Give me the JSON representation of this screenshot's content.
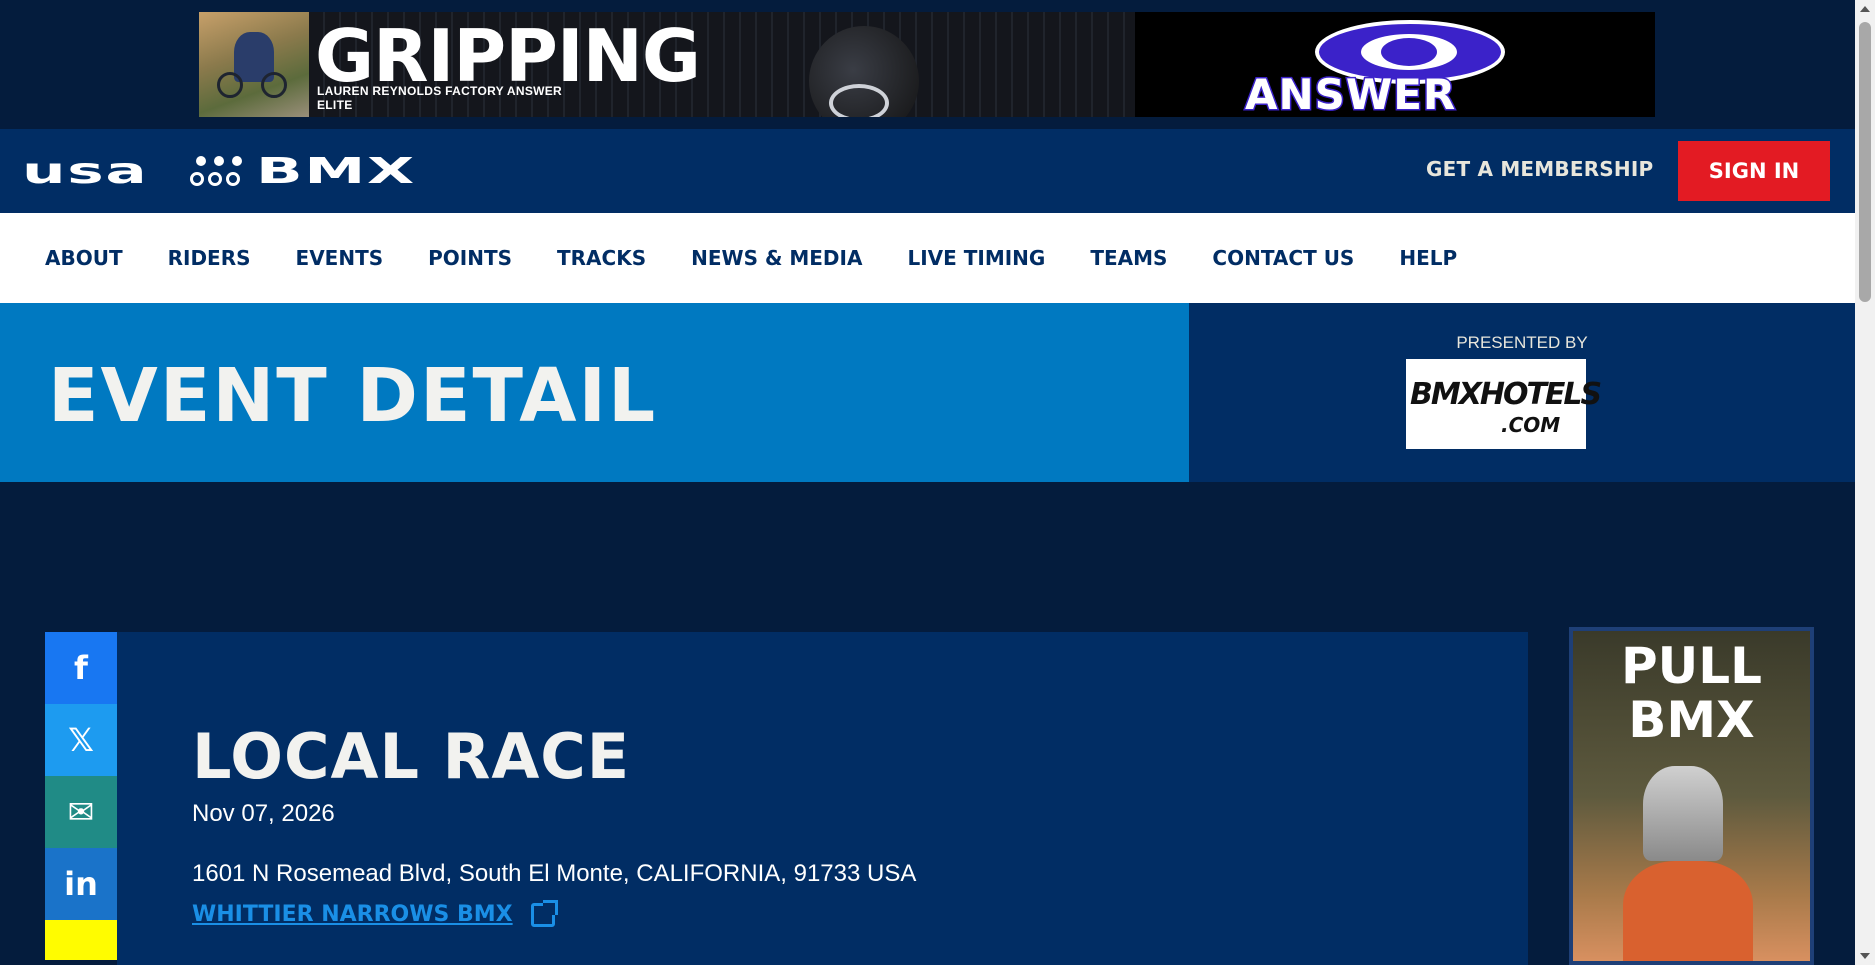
{
  "top_ad": {
    "headline": "GRIPPING",
    "line1": "LAUREN REYNOLDS  FACTORY ANSWER",
    "line2": "ELITE",
    "brand": "ANSWER"
  },
  "header": {
    "logo_left": "usa",
    "logo_right": "BMX",
    "membership_label": "GET A MEMBERSHIP",
    "signin_label": "SIGN IN"
  },
  "nav": {
    "items": [
      "ABOUT",
      "RIDERS",
      "EVENTS",
      "POINTS",
      "TRACKS",
      "NEWS & MEDIA",
      "LIVE TIMING",
      "TEAMS",
      "CONTACT US",
      "HELP"
    ]
  },
  "hero": {
    "title": "EVENT DETAIL",
    "presented_by": "PRESENTED BY",
    "sponsor_text": "BMXHOTELS",
    "sponsor_com": ".COM"
  },
  "social": {
    "facebook": "f",
    "x": "𝕏",
    "email": "✉",
    "linkedin": "in"
  },
  "event": {
    "title": "LOCAL RACE",
    "date": "Nov 07, 2026",
    "address": "1601 N Rosemead Blvd, South El Monte, CALIFORNIA, 91733 USA",
    "track_link": "WHITTIER NARROWS BMX"
  },
  "side_ad": {
    "line1": "PULL",
    "line2": "BMX"
  },
  "colors": {
    "page_bg": "#041c3d",
    "header_bg": "#012d64",
    "hero_blue": "#0079c1",
    "signin_red": "#e31b23",
    "link_blue": "#1a8fe6"
  }
}
